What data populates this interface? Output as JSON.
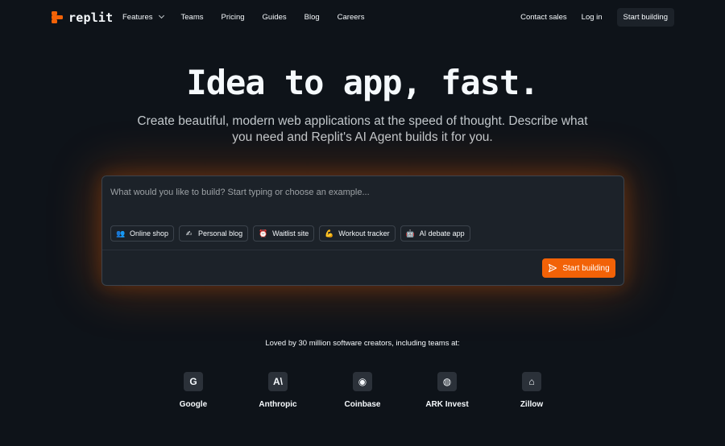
{
  "brand": {
    "name": "replit",
    "accent": "#f26207"
  },
  "nav": {
    "links": [
      {
        "label": "Features",
        "has_dropdown": true
      },
      {
        "label": "Teams"
      },
      {
        "label": "Pricing"
      },
      {
        "label": "Guides"
      },
      {
        "label": "Blog"
      },
      {
        "label": "Careers"
      }
    ],
    "right": {
      "contact": "Contact sales",
      "login": "Log in",
      "cta": "Start building"
    }
  },
  "hero": {
    "title": "Idea to app, fast.",
    "subtitle": "Create beautiful, modern web applications at the speed of thought. Describe what you need and Replit's AI Agent builds it for you."
  },
  "prompt": {
    "placeholder": "What would you like to build? Start typing or choose an example...",
    "value": "",
    "chips": [
      {
        "icon": "👥",
        "label": "Online shop"
      },
      {
        "icon": "✍",
        "label": "Personal blog"
      },
      {
        "icon": "⏰",
        "label": "Waitlist site"
      },
      {
        "icon": "💪",
        "label": "Workout tracker"
      },
      {
        "icon": "🤖",
        "label": "AI debate app"
      }
    ],
    "submit_label": "Start building"
  },
  "social_proof": {
    "text": "Loved by 30 million software creators, including teams at:",
    "logos": [
      {
        "name": "Google",
        "glyph": "G"
      },
      {
        "name": "Anthropic",
        "glyph": "A\\"
      },
      {
        "name": "Coinbase",
        "glyph": "◉"
      },
      {
        "name": "ARK Invest",
        "glyph": "◍"
      },
      {
        "name": "Zillow",
        "glyph": "⌂"
      }
    ]
  }
}
